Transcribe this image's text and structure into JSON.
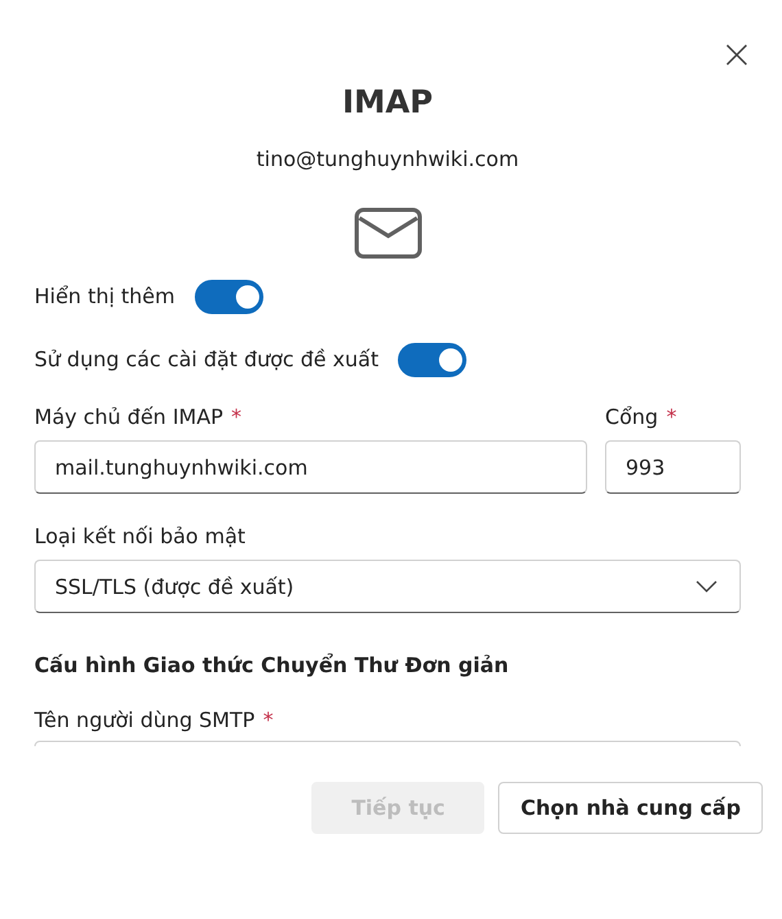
{
  "dialog": {
    "title": "IMAP",
    "account": "tino@tunghuynhwiki.com"
  },
  "toggles": [
    {
      "label": "Hiển thị thêm",
      "on": true
    },
    {
      "label": "Sử dụng các cài đặt được đề xuất",
      "on": true
    }
  ],
  "server_fields": [
    {
      "label": "Máy chủ đến IMAP",
      "required_mark": "*",
      "value": "mail.tunghuynhwiki.com",
      "kind": "wide"
    },
    {
      "label": "Cổng",
      "required_mark": "*",
      "value": "993",
      "kind": "narrow"
    }
  ],
  "security": {
    "label": "Loại kết nối bảo mật",
    "value": "SSL/TLS (được đề xuất)"
  },
  "smtp_section": {
    "heading": "Cấu hình Giao thức Chuyển Thư Đơn giản",
    "username_label": "Tên người dùng SMTP",
    "required_mark": "*"
  },
  "buttons": [
    {
      "label": "Tiếp tục",
      "disabled": true
    },
    {
      "label": "Chọn nhà cung cấp",
      "disabled": false
    }
  ]
}
